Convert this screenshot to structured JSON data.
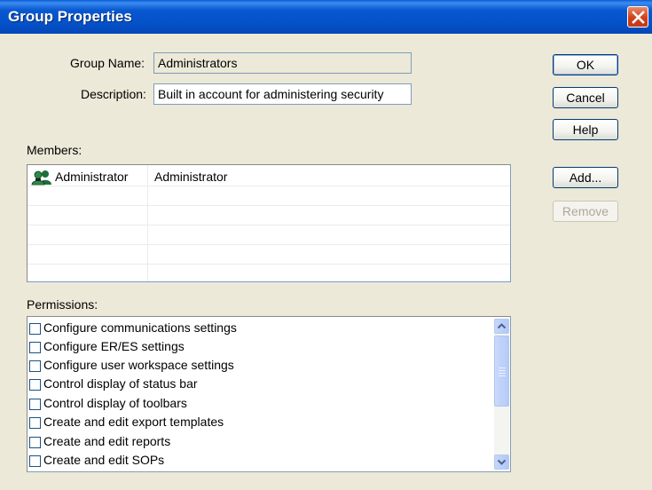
{
  "window": {
    "title": "Group Properties"
  },
  "form": {
    "group_name_label": "Group Name:",
    "group_name_value": "Administrators",
    "description_label": "Description:",
    "description_value": "Built in account for administering security"
  },
  "buttons": {
    "ok": "OK",
    "cancel": "Cancel",
    "help": "Help",
    "add": "Add...",
    "remove": "Remove"
  },
  "members": {
    "label": "Members:",
    "rows": [
      {
        "name": "Administrator",
        "full_name": "Administrator",
        "icon": "users-icon"
      }
    ]
  },
  "permissions": {
    "label": "Permissions:",
    "items": [
      {
        "label": "Configure communications settings",
        "checked": false
      },
      {
        "label": "Configure ER/ES settings",
        "checked": false
      },
      {
        "label": "Configure user workspace settings",
        "checked": false
      },
      {
        "label": "Control display of status bar",
        "checked": false
      },
      {
        "label": "Control display of toolbars",
        "checked": false
      },
      {
        "label": "Create and edit export templates",
        "checked": false
      },
      {
        "label": "Create and edit reports",
        "checked": false
      },
      {
        "label": "Create and edit SOPs",
        "checked": false
      }
    ]
  },
  "colors": {
    "titlebar": "#0451c8",
    "dialog_bg": "#ece9d8",
    "close_button": "#d0401c"
  }
}
